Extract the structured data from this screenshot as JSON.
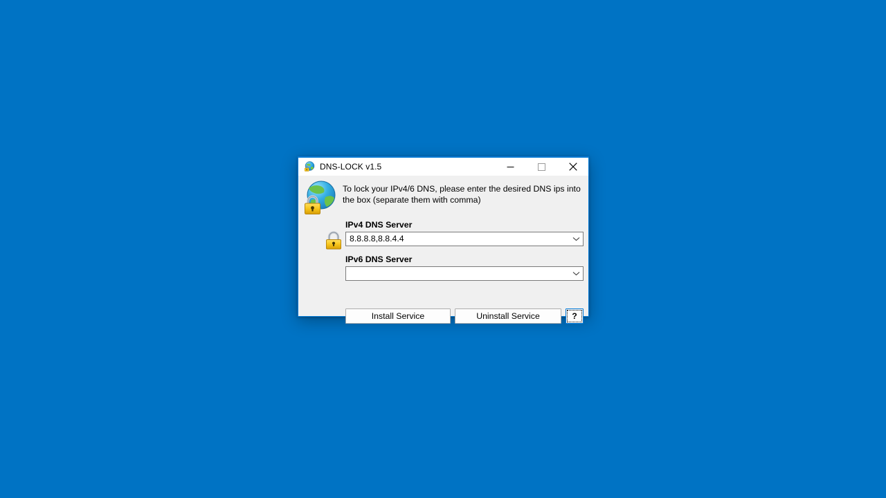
{
  "desktop": {
    "background_color": "#0073c4"
  },
  "window": {
    "title": "DNS-LOCK v1.5",
    "icon": "globe-lock-icon",
    "accent_color": "#0078d4",
    "titlebar_color": "#ffffff",
    "body_color": "#f0f0f0",
    "controls": {
      "minimize_label": "Minimize",
      "maximize_label": "Maximize",
      "close_label": "Close"
    }
  },
  "dialog": {
    "app_icon": "globe-lock-icon",
    "description": "To lock your IPv4/6 DNS, please enter the desired DNS ips into the box (separate them with comma)",
    "lock_icon": "padlock-icon",
    "fields": [
      {
        "label": "IPv4 DNS Server",
        "value": "8.8.8.8,8.8.4.4",
        "placeholder": ""
      },
      {
        "label": "IPv6 DNS Server",
        "value": "",
        "placeholder": ""
      }
    ],
    "buttons": {
      "install": "Install Service",
      "uninstall": "Uninstall Service",
      "help": "?"
    }
  }
}
